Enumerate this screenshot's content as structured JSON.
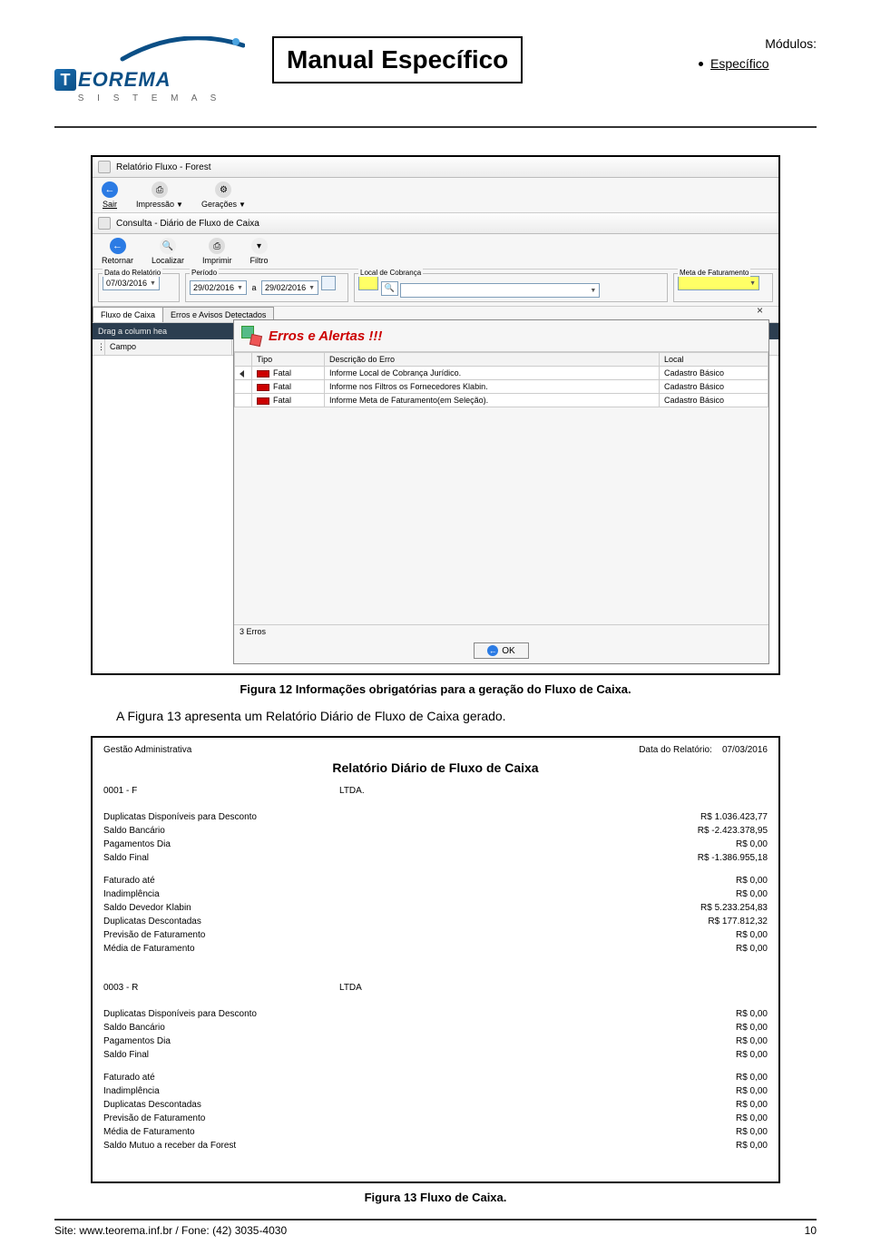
{
  "header": {
    "logo": {
      "brand_t": "T",
      "brand_rest": "EOREMA",
      "sub": "S I S T E M A S"
    },
    "title": "Manual Específico",
    "modules_heading": "Módulos:",
    "modules_item": "Específico"
  },
  "screenshot1": {
    "win1_title": "Relatório Fluxo - Forest",
    "toolbar1": {
      "sair": "Sair",
      "impressao": "Impressão",
      "geracoes": "Gerações"
    },
    "win2_title": "Consulta  -  Diário de Fluxo de Caixa",
    "toolbar2": {
      "retornar": "Retornar",
      "localizar": "Localizar",
      "imprimir": "Imprimir",
      "filtro": "Filtro"
    },
    "filters": {
      "data_rel_label": "Data do Relatório",
      "data_rel_value": "07/03/2016",
      "periodo_label": "Período",
      "periodo_from": "29/02/2016",
      "periodo_sep": "a",
      "periodo_to": "29/02/2016",
      "local_cob_label": "Local de Cobrança",
      "meta_fat_label": "Meta de Faturamento"
    },
    "tabs": {
      "t1": "Fluxo de Caixa",
      "t2": "Erros e Avisos Detectados"
    },
    "drag_hint": "Drag a column hea",
    "campo": "Campo",
    "modal": {
      "title": "Erros e Alertas !!!",
      "close": "×",
      "columns": {
        "c1": "Tipo",
        "c2": "Descrição do Erro",
        "c3": "Local"
      },
      "rows": [
        {
          "tipo": "Fatal",
          "desc": "Informe Local de Cobrança Jurídico.",
          "local": "Cadastro Básico"
        },
        {
          "tipo": "Fatal",
          "desc": "Informe nos Filtros os Fornecedores Klabin.",
          "local": "Cadastro Básico"
        },
        {
          "tipo": "Fatal",
          "desc": "Informe Meta de Faturamento(em Seleção).",
          "local": "Cadastro Básico"
        }
      ],
      "footer": "3 Erros",
      "ok": "OK"
    }
  },
  "caption1": "Figura 12 Informações obrigatórias para a geração do Fluxo de Caixa.",
  "body_text": "A Figura 13 apresenta um Relatório Diário de Fluxo de Caixa gerado.",
  "screenshot2": {
    "top_left": "Gestão Administrativa",
    "top_right_label": "Data do Relatório:",
    "top_right_value": "07/03/2016",
    "title": "Relatório Diário de Fluxo de Caixa",
    "sections": [
      {
        "code": "0001 - F",
        "name": "LTDA.",
        "group1": [
          {
            "l": "Duplicatas Disponíveis para Desconto",
            "v": "R$ 1.036.423,77"
          },
          {
            "l": "Saldo Bancário",
            "v": "R$ -2.423.378,95"
          },
          {
            "l": "Pagamentos Dia",
            "v": "R$ 0,00"
          },
          {
            "l": "Saldo Final",
            "v": "R$ -1.386.955,18"
          }
        ],
        "group2": [
          {
            "l": "Faturado até",
            "v": "R$ 0,00"
          },
          {
            "l": "Inadimplência",
            "v": "R$ 0,00"
          },
          {
            "l": "Saldo Devedor Klabin",
            "v": "R$ 5.233.254,83"
          },
          {
            "l": "Duplicatas Descontadas",
            "v": "R$ 177.812,32"
          },
          {
            "l": "Previsão de Faturamento",
            "v": "R$ 0,00"
          },
          {
            "l": "Média de Faturamento",
            "v": "R$ 0,00"
          }
        ]
      },
      {
        "code": "0003 - R",
        "name": "LTDA",
        "group1": [
          {
            "l": "Duplicatas Disponíveis para Desconto",
            "v": "R$ 0,00"
          },
          {
            "l": "Saldo Bancário",
            "v": "R$ 0,00"
          },
          {
            "l": "Pagamentos Dia",
            "v": "R$ 0,00"
          },
          {
            "l": "Saldo Final",
            "v": "R$ 0,00"
          }
        ],
        "group2": [
          {
            "l": "Faturado até",
            "v": "R$ 0,00"
          },
          {
            "l": "Inadimplência",
            "v": "R$ 0,00"
          },
          {
            "l": "Duplicatas Descontadas",
            "v": "R$ 0,00"
          },
          {
            "l": "Previsão de Faturamento",
            "v": "R$ 0,00"
          },
          {
            "l": "Média de Faturamento",
            "v": "R$ 0,00"
          },
          {
            "l": "Saldo Mutuo a receber da Forest",
            "v": "R$ 0,00"
          }
        ]
      }
    ]
  },
  "caption2": "Figura 13 Fluxo de Caixa.",
  "footer": {
    "site": "Site: www.teorema.inf.br / Fone: (42) 3035-4030",
    "page": "10"
  }
}
